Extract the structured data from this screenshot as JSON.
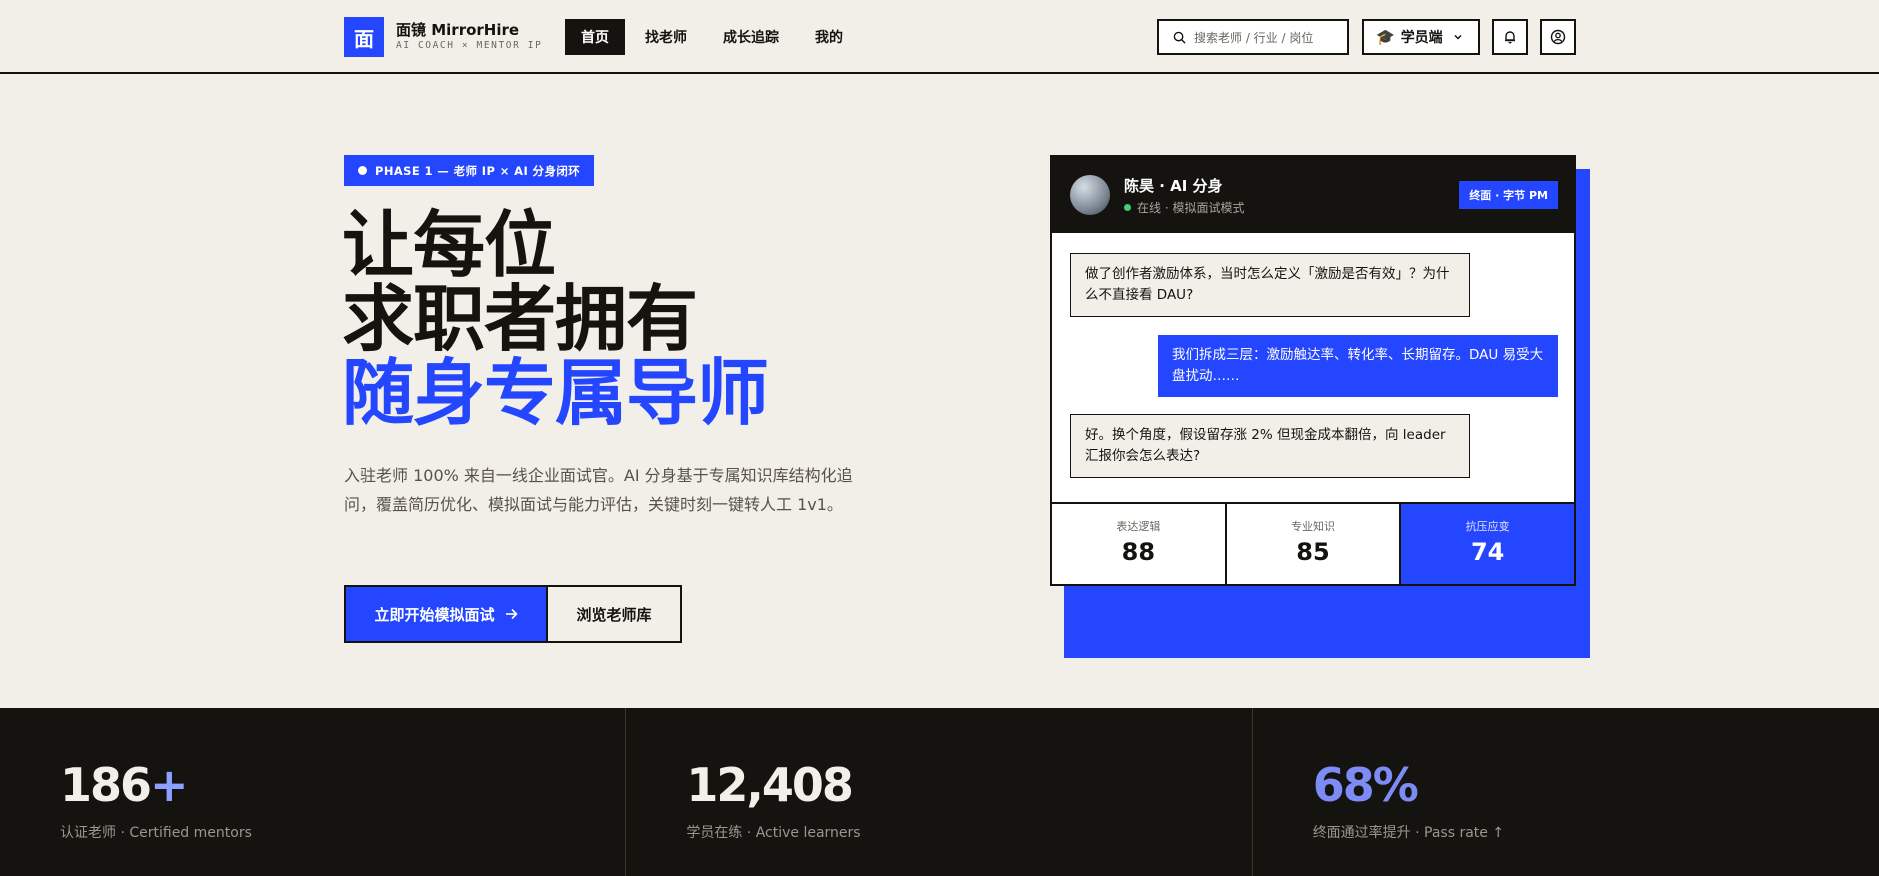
{
  "header": {
    "logo_char": "面",
    "brand_name": "面镜 MirrorHire",
    "brand_sub": "AI COACH × MENTOR IP",
    "nav": [
      "首页",
      "找老师",
      "成长追踪",
      "我的"
    ],
    "search_placeholder": "搜索老师 / 行业 / 岗位",
    "role_label": "学员端",
    "icons": [
      "bell-icon",
      "user-icon"
    ]
  },
  "hero": {
    "badge": "PHASE 1 — 老师 IP × AI 分身闭环",
    "title_line1": "让每位",
    "title_line2": "求职者拥有",
    "title_line3": "随身专属导师",
    "lead": "入驻老师 100% 来自一线企业面试官。AI 分身基于专属知识库结构化追问，覆盖简历优化、模拟面试与能力评估，关键时刻一键转人工 1v1。",
    "cta_primary": "立即开始模拟面试",
    "cta_secondary": "浏览老师库"
  },
  "chat_card": {
    "name": "陈昊 · AI 分身",
    "status": "在线 · 模拟面试模式",
    "tag": "终面 · 字节 PM",
    "messages": [
      {
        "role": "q",
        "text": "做了创作者激励体系，当时怎么定义「激励是否有效」？为什么不直接看 DAU?"
      },
      {
        "role": "a",
        "text": "我们拆成三层：激励触达率、转化率、长期留存。DAU 易受大盘扰动……"
      },
      {
        "role": "q",
        "text": "好。换个角度，假设留存涨 2% 但现金成本翻倍，向 leader 汇报你会怎么表达?"
      }
    ],
    "scores": [
      {
        "label": "表达逻辑",
        "value": "88"
      },
      {
        "label": "专业知识",
        "value": "85"
      },
      {
        "label": "抗压应变",
        "value": "74"
      }
    ]
  },
  "stats": [
    {
      "number": "186",
      "suffix": "+",
      "caption": "认证老师 · Certified mentors"
    },
    {
      "number": "12,408",
      "suffix": "",
      "caption": "学员在练 · Active learners"
    },
    {
      "number": "68%",
      "suffix": "",
      "caption": "终面通过率提升 · Pass rate ↑"
    }
  ],
  "colors": {
    "accent": "#2446ff",
    "ink": "#15130f",
    "paper": "#f2efe9"
  }
}
